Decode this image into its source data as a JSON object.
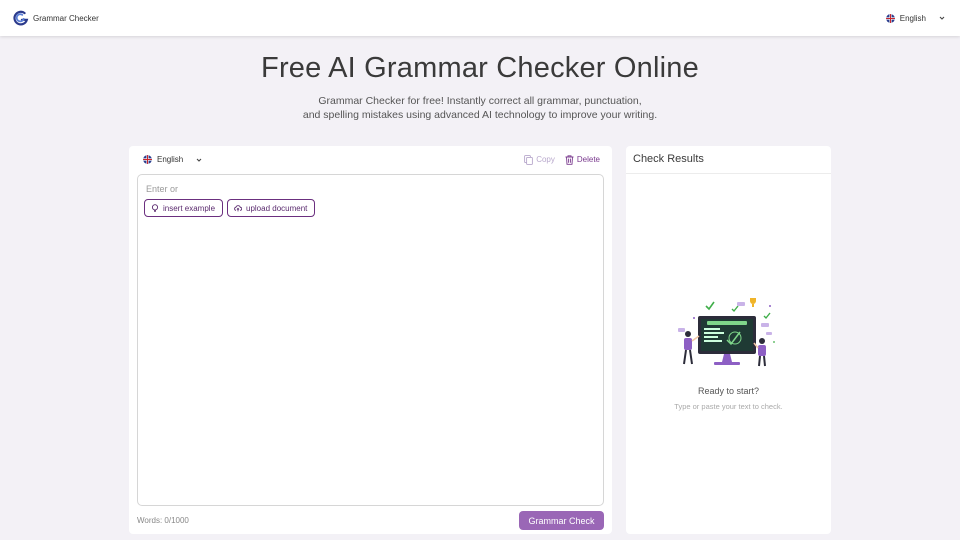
{
  "header": {
    "brand": "Grammar Checker",
    "language": "English"
  },
  "hero": {
    "title": "Free AI Grammar Checker Online",
    "subtitle_line1": "Grammar Checker for free! Instantly correct all grammar, punctuation,",
    "subtitle_line2": "and spelling mistakes using advanced AI technology to improve your writing."
  },
  "editor": {
    "language": "English",
    "copy_label": "Copy",
    "delete_label": "Delete",
    "placeholder": "Enter or",
    "insert_example_label": "insert example",
    "upload_document_label": "upload document",
    "word_count": "Words: 0/1000",
    "check_button": "Grammar Check"
  },
  "results": {
    "title": "Check Results",
    "ready": "Ready to start?",
    "ready_sub": "Type or paste your text to check."
  },
  "colors": {
    "accent": "#9a67b6",
    "accent_dark": "#6b2f7f",
    "brand_blue": "#2b3a8c"
  },
  "icons": {
    "logo": "grammar-checker-logo",
    "flag": "uk-flag-icon",
    "chevron": "chevron-down-icon",
    "copy": "copy-icon",
    "delete": "trash-icon",
    "example": "lightbulb-icon",
    "upload": "cloud-upload-icon"
  }
}
